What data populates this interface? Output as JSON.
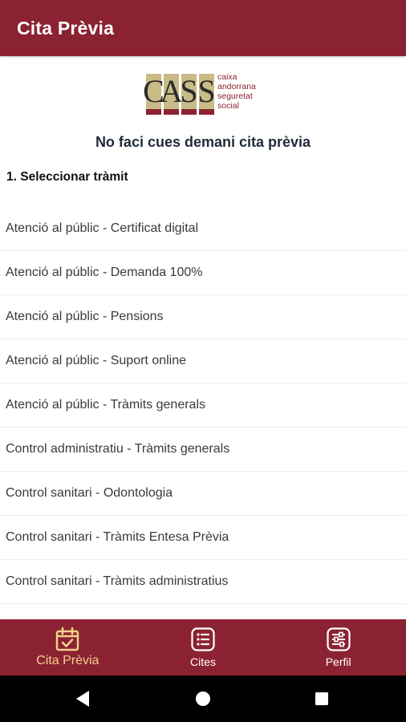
{
  "app_bar": {
    "title": "Cita Prèvia"
  },
  "logo": {
    "letters": [
      "C",
      "A",
      "S",
      "S"
    ],
    "tagline": [
      "caixa",
      "andorrana",
      "seguretat",
      "social"
    ]
  },
  "headline": "No faci cues demani cita prèvia",
  "section_label": "1. Seleccionar tràmit",
  "procedures": [
    "Atenció al públic - Certificat digital",
    "Atenció al públic - Demanda 100%",
    "Atenció al públic - Pensions",
    "Atenció al públic - Suport online",
    "Atenció al públic - Tràmits generals",
    "Control administratiu - Tràmits generals",
    "Control sanitari - Odontologia",
    "Control sanitari - Tràmits Entesa Prèvia",
    "Control sanitari - Tràmits administratius"
  ],
  "bottom_nav": {
    "items": [
      {
        "label": "Cita Prèvia",
        "icon": "calendar-check-icon",
        "active": true
      },
      {
        "label": "Cites",
        "icon": "list-icon",
        "active": false
      },
      {
        "label": "Perfil",
        "icon": "sliders-icon",
        "active": false
      }
    ]
  },
  "system_nav": {
    "buttons": [
      "back-icon",
      "home-icon",
      "recents-icon"
    ]
  },
  "colors": {
    "primary": "#8b2232",
    "active_nav": "#f2d28a",
    "logo_gold": "#c9bb86",
    "headline_text": "#1f2a3a"
  }
}
